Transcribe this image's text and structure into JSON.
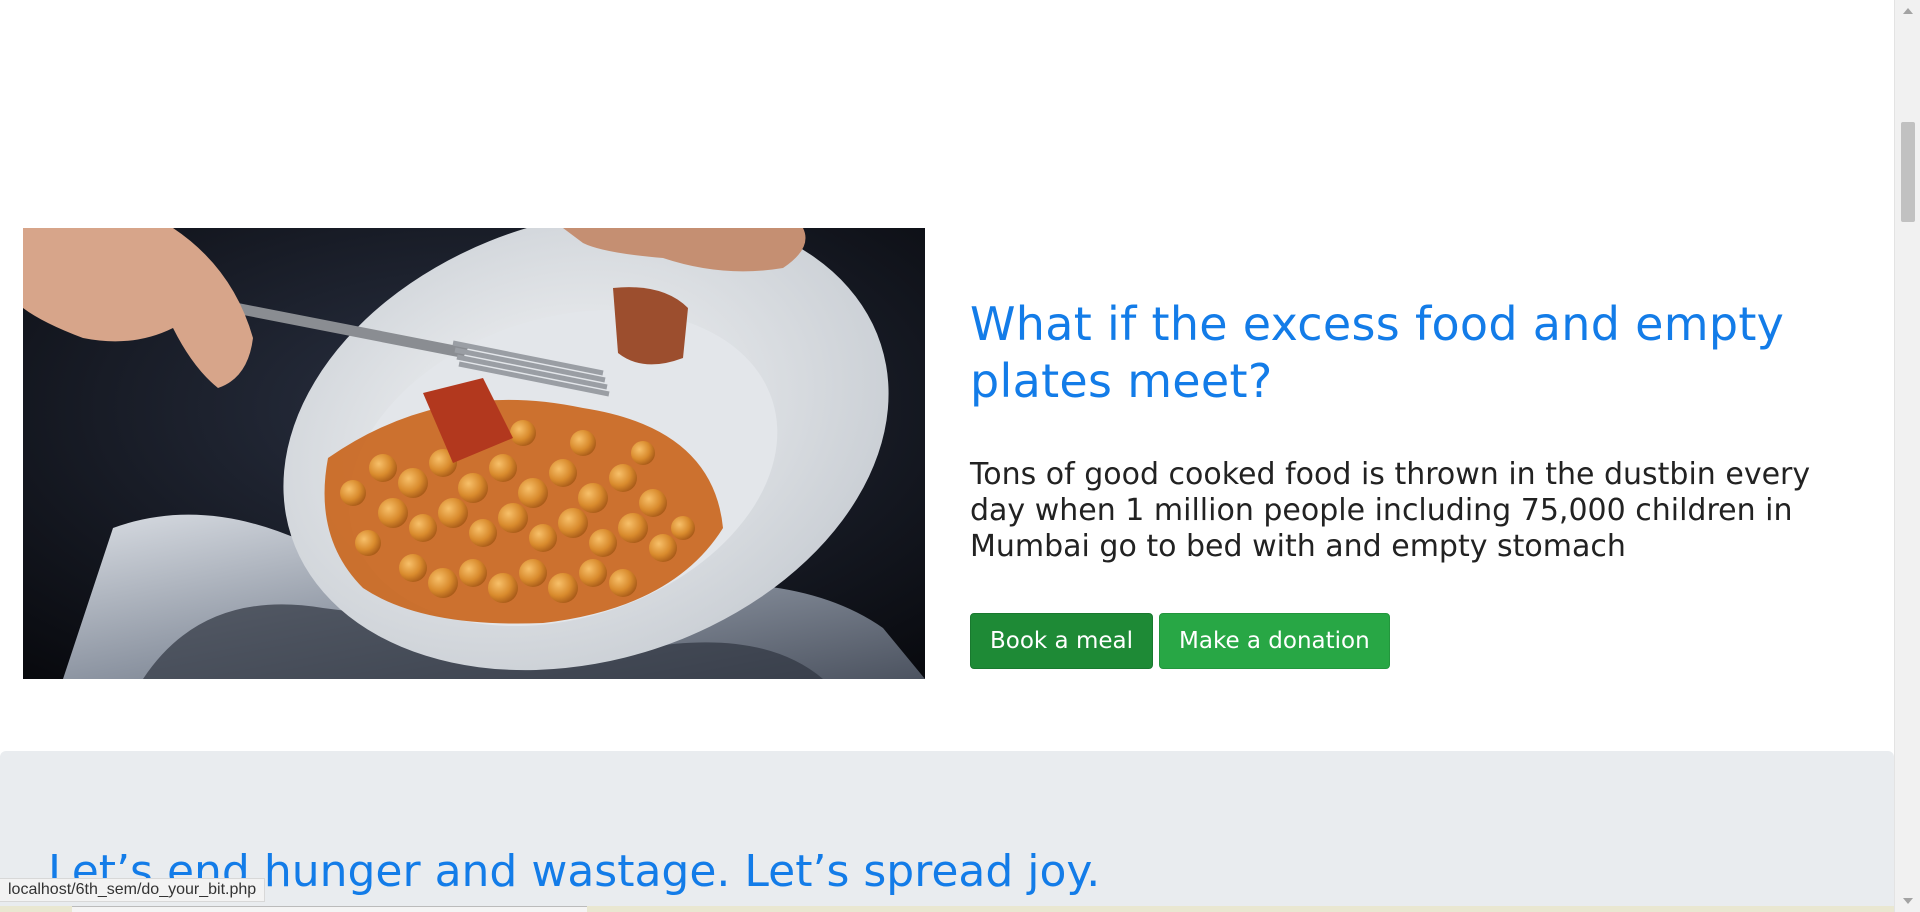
{
  "hero": {
    "image_alt": "Plate of leftover chickpea curry being scraped into a dustbin",
    "title": "What if the excess food and empty plates meet?",
    "description": "Tons of good cooked food is thrown in the dustbin every day when 1 million people including 75,000 children in Mumbai go to bed with and empty stomach",
    "buttons": {
      "book_meal": "Book a meal",
      "donate": "Make a donation"
    }
  },
  "band": {
    "title": "Let’s end hunger and wastage. Let’s spread joy."
  },
  "statusbar": {
    "url": "localhost/6th_sem/do_your_bit.php"
  },
  "colors": {
    "accent": "#137ce8",
    "button_dark": "#1e8a36",
    "button_green": "#28a745",
    "band_bg": "#e9ecef"
  }
}
